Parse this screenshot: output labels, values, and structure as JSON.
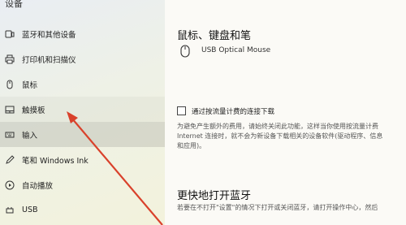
{
  "sidebar": {
    "title": "设备",
    "items": [
      {
        "label": "蓝牙和其他设备",
        "icon": "bluetooth-devices-icon"
      },
      {
        "label": "打印机和扫描仪",
        "icon": "printer-icon"
      },
      {
        "label": "鼠标",
        "icon": "mouse-icon"
      },
      {
        "label": "触摸板",
        "icon": "touchpad-icon"
      },
      {
        "label": "输入",
        "icon": "keyboard-icon"
      },
      {
        "label": "笔和 Windows Ink",
        "icon": "pen-icon"
      },
      {
        "label": "自动播放",
        "icon": "autoplay-icon"
      },
      {
        "label": "USB",
        "icon": "usb-icon"
      }
    ]
  },
  "main": {
    "section1_title": "鼠标、键盘和笔",
    "device_name": "USB Optical Mouse",
    "metered_label": "通过按流量计费的连接下载",
    "metered_desc_line1": "为避免产生额外的费用，请始终关闭此功能，这样当你使用按流量计费",
    "metered_desc_line2": "Internet 连接时，就不会为新设备下载相关的设备软件(驱动程序、信息",
    "metered_desc_line3": "和应用)。",
    "section2_title": "更快地打开蓝牙",
    "section2_desc": "若要在不打开\"设置\"的情况下打开或关闭蓝牙，请打开操作中心，然后"
  },
  "colors": {
    "annotation_arrow": "#d9412b",
    "selected_bg": "#e1e1db"
  }
}
